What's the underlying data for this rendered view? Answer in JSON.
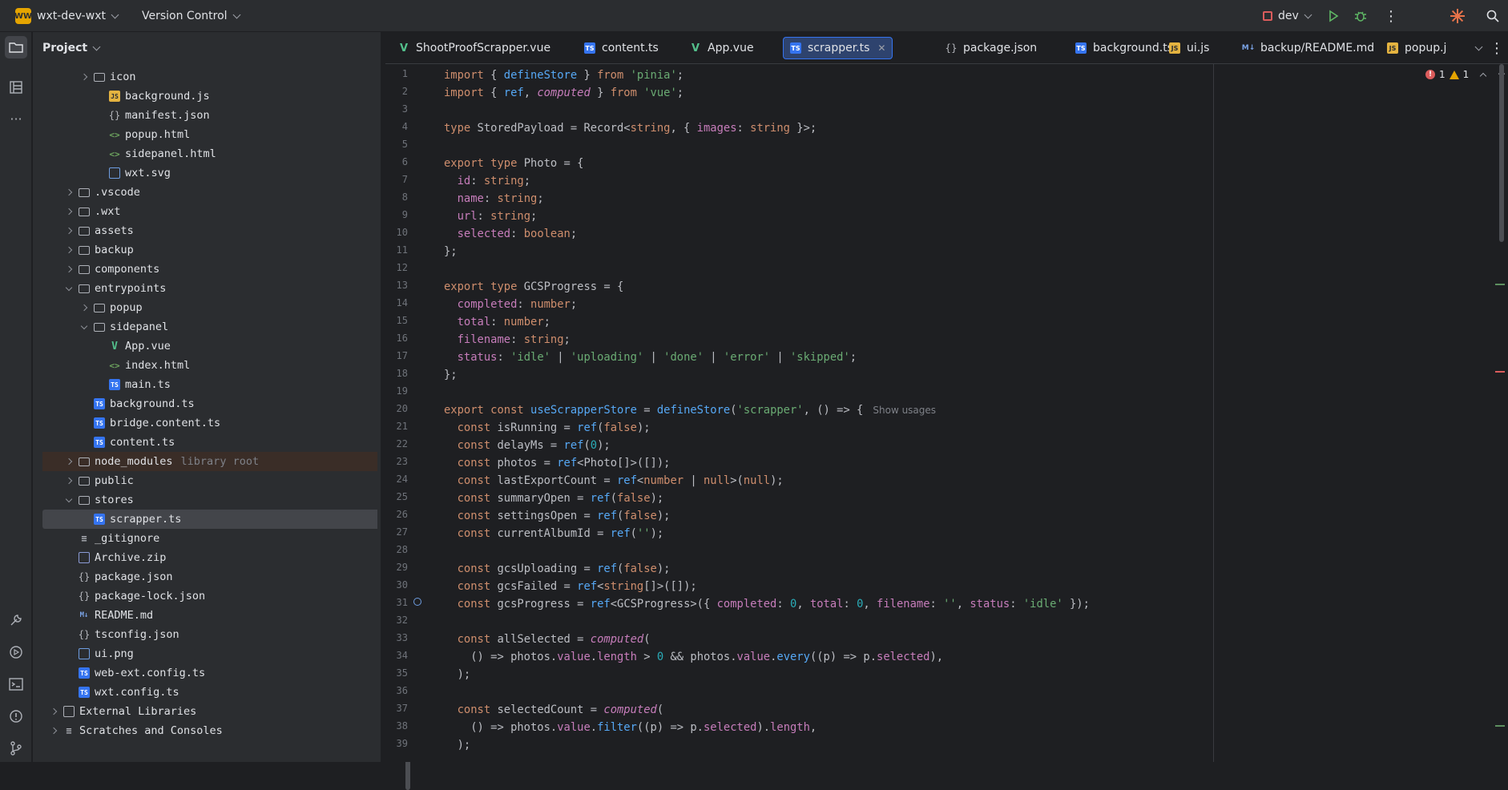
{
  "titlebar": {
    "project_badge": "WW",
    "project_name": "wxt-dev-wxt",
    "vcs": "Version Control",
    "run_config": "dev"
  },
  "colors": {
    "accent": "#3574f0",
    "error": "#db5c5c",
    "warning": "#e5a400",
    "added": "#6aab73"
  },
  "project_panel": {
    "title": "Project",
    "rows": [
      {
        "label": "icon",
        "hint": ""
      },
      {
        "label": "background.js",
        "hint": ""
      },
      {
        "label": "manifest.json",
        "hint": ""
      },
      {
        "label": "popup.html",
        "hint": ""
      },
      {
        "label": "sidepanel.html",
        "hint": ""
      },
      {
        "label": "wxt.svg",
        "hint": ""
      },
      {
        "label": ".vscode",
        "hint": ""
      },
      {
        "label": ".wxt",
        "hint": ""
      },
      {
        "label": "assets",
        "hint": ""
      },
      {
        "label": "backup",
        "hint": ""
      },
      {
        "label": "components",
        "hint": ""
      },
      {
        "label": "entrypoints",
        "hint": ""
      },
      {
        "label": "popup",
        "hint": ""
      },
      {
        "label": "sidepanel",
        "hint": ""
      },
      {
        "label": "App.vue",
        "hint": ""
      },
      {
        "label": "index.html",
        "hint": ""
      },
      {
        "label": "main.ts",
        "hint": ""
      },
      {
        "label": "background.ts",
        "hint": ""
      },
      {
        "label": "bridge.content.ts",
        "hint": ""
      },
      {
        "label": "content.ts",
        "hint": ""
      },
      {
        "label": "node_modules",
        "hint": "library root"
      },
      {
        "label": "public",
        "hint": ""
      },
      {
        "label": "stores",
        "hint": ""
      },
      {
        "label": "scrapper.ts",
        "hint": ""
      },
      {
        "label": "_gitignore",
        "hint": ""
      },
      {
        "label": "Archive.zip",
        "hint": ""
      },
      {
        "label": "package.json",
        "hint": ""
      },
      {
        "label": "package-lock.json",
        "hint": ""
      },
      {
        "label": "README.md",
        "hint": ""
      },
      {
        "label": "tsconfig.json",
        "hint": ""
      },
      {
        "label": "ui.png",
        "hint": ""
      },
      {
        "label": "web-ext.config.ts",
        "hint": ""
      },
      {
        "label": "wxt.config.ts",
        "hint": ""
      },
      {
        "label": "External Libraries",
        "hint": ""
      },
      {
        "label": "Scratches and Consoles",
        "hint": ""
      }
    ]
  },
  "tabs": [
    {
      "label": "ShootProofScrapper.vue",
      "icon": "vue-file-icon"
    },
    {
      "label": "content.ts",
      "icon": "ts-file-icon"
    },
    {
      "label": "App.vue",
      "icon": "vue-file-icon"
    },
    {
      "label": "scrapper.ts",
      "icon": "ts-file-icon",
      "active": true
    },
    {
      "label": "package.json",
      "icon": "json-file-icon"
    },
    {
      "label": "background.ts",
      "icon": "ts-file-icon"
    },
    {
      "label": "ui.js",
      "icon": "js-file-icon"
    },
    {
      "label": "backup/README.md",
      "icon": "md-file-icon"
    },
    {
      "label": "popup.j",
      "icon": "js-file-icon"
    }
  ],
  "inspections": {
    "errors": "1",
    "warnings": "1"
  },
  "code": {
    "line_numbers": [
      "1",
      "2",
      "3",
      "4",
      "5",
      "6",
      "7",
      "8",
      "9",
      "10",
      "11",
      "12",
      "13",
      "14",
      "15",
      "16",
      "17",
      "18",
      "19",
      "20",
      "21",
      "22",
      "23",
      "24",
      "25",
      "26",
      "27",
      "28",
      "29",
      "30",
      "31",
      "32",
      "33",
      "34",
      "35",
      "36",
      "37",
      "38",
      "39"
    ],
    "lines": [
      "import { defineStore } from 'pinia';",
      "import { ref, computed } from 'vue';",
      "",
      "type StoredPayload = Record<string, { images: string }>;",
      "",
      "export type Photo = {",
      "  id: string;",
      "  name: string;",
      "  url: string;",
      "  selected: boolean;",
      "};",
      "",
      "export type GCSProgress = {",
      "  completed: number;",
      "  total: number;",
      "  filename: string;",
      "  status: 'idle' | 'uploading' | 'done' | 'error' | 'skipped';",
      "};",
      "",
      "export const useScrapperStore = defineStore('scrapper', () => {",
      "  const isRunning = ref(false);",
      "  const delayMs = ref(0);",
      "  const photos = ref<Photo[]>([]);",
      "  const lastExportCount = ref<number | null>(null);",
      "  const summaryOpen = ref(false);",
      "  const settingsOpen = ref(false);",
      "  const currentAlbumId = ref('');",
      "",
      "  const gcsUploading = ref(false);",
      "  const gcsFailed = ref<string[]>([]);",
      "  const gcsProgress = ref<GCSProgress>({ completed: 0, total: 0, filename: '', status: 'idle' });",
      "",
      "  const allSelected = computed(",
      "    () => photos.value.length > 0 && photos.value.every((p) => p.selected),",
      "  );",
      "",
      "  const selectedCount = computed(",
      "    () => photos.value.filter((p) => p.selected).length,",
      "  );"
    ],
    "inlay_hint": "Show usages"
  }
}
